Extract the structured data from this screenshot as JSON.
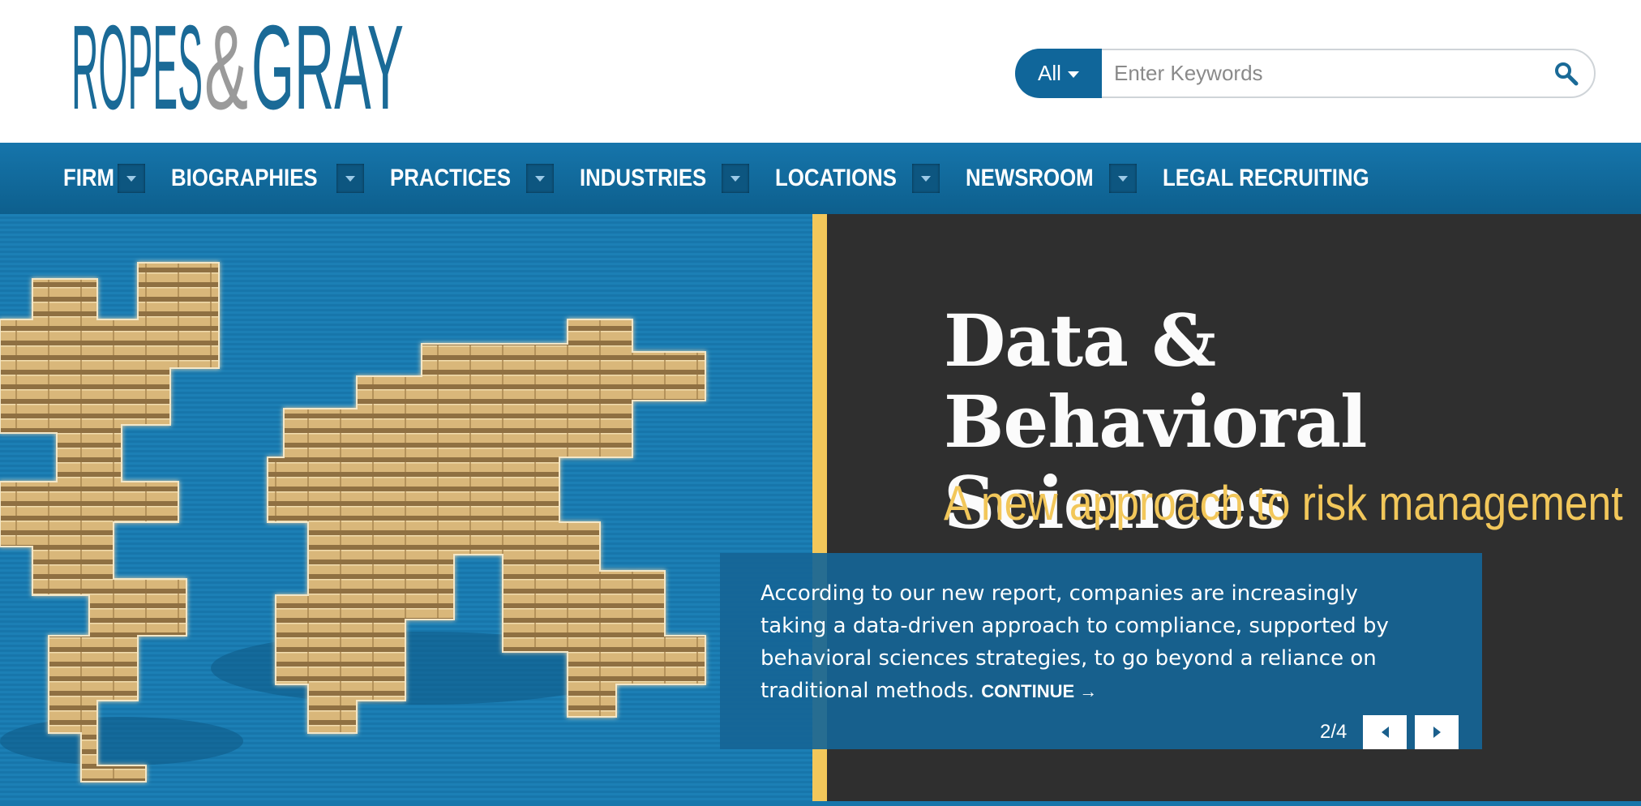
{
  "header": {
    "logo": {
      "word1": "ROPES",
      "amp": "&",
      "word2": "GRAY"
    },
    "search": {
      "scope_label": "All",
      "placeholder": "Enter Keywords",
      "value": ""
    }
  },
  "nav": {
    "items": [
      {
        "label": "FIRM",
        "has_dropdown": true
      },
      {
        "label": "BIOGRAPHIES",
        "has_dropdown": true
      },
      {
        "label": "PRACTICES",
        "has_dropdown": true
      },
      {
        "label": "INDUSTRIES",
        "has_dropdown": true
      },
      {
        "label": "LOCATIONS",
        "has_dropdown": true
      },
      {
        "label": "NEWSROOM",
        "has_dropdown": true
      },
      {
        "label": "LEGAL RECRUITING",
        "has_dropdown": false
      }
    ]
  },
  "hero": {
    "title": "Data & Behavioral Sciences",
    "subtitle": "A new approach to risk management",
    "caption": "According to our new report, companies are increasingly taking a data-driven approach to compliance, supported by behavioral sciences strategies, to go beyond a reliance on traditional methods.",
    "continue_label": "CONTINUE →",
    "pager": "2/4"
  },
  "colors": {
    "brand_blue": "#1a6a97",
    "nav_blue": "#1675ab",
    "accent_gold": "#f2c75a",
    "hero_dark": "#2f2f2f"
  },
  "icons": {
    "search": "search-icon",
    "prev": "arrow-left-icon",
    "next": "arrow-right-icon"
  }
}
